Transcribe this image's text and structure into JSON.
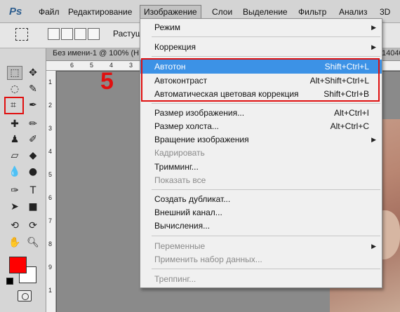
{
  "app": {
    "logo": "Ps"
  },
  "menubar": {
    "items": [
      "Файл",
      "Редактирование",
      "Изображение",
      "Слои",
      "Выделение",
      "Фильтр",
      "Анализ",
      "3D"
    ]
  },
  "options_bar": {
    "label": "Растуше"
  },
  "document": {
    "title": "Без имени-1 @ 100% (H",
    "right_tab": "14040"
  },
  "ruler": {
    "ticks": [
      "6",
      "5",
      "4",
      "3",
      "2"
    ],
    "vticks": [
      "1",
      "2",
      "3",
      "4",
      "5",
      "6",
      "7",
      "8",
      "9",
      "1"
    ]
  },
  "annotation": {
    "step": "5"
  },
  "tools": {
    "foreground_color": "#ff0000",
    "background_color": "#ffffff"
  },
  "menu": {
    "items": [
      {
        "label": "Режим",
        "submenu": true
      },
      {
        "label": "Коррекция",
        "submenu": true
      },
      {
        "label": "Автотон",
        "shortcut": "Shift+Ctrl+L",
        "highlighted": true
      },
      {
        "label": "Автоконтраст",
        "shortcut": "Alt+Shift+Ctrl+L"
      },
      {
        "label": "Автоматическая цветовая коррекция",
        "shortcut": "Shift+Ctrl+B"
      },
      {
        "label": "Размер изображения...",
        "shortcut": "Alt+Ctrl+I"
      },
      {
        "label": "Размер холста...",
        "shortcut": "Alt+Ctrl+C"
      },
      {
        "label": "Вращение изображения",
        "submenu": true
      },
      {
        "label": "Кадрировать",
        "disabled": true
      },
      {
        "label": "Тримминг..."
      },
      {
        "label": "Показать все",
        "disabled": true
      },
      {
        "label": "Создать дубликат..."
      },
      {
        "label": "Внешний канал..."
      },
      {
        "label": "Вычисления..."
      },
      {
        "label": "Переменные",
        "submenu": true,
        "disabled": true
      },
      {
        "label": "Применить набор данных...",
        "disabled": true
      },
      {
        "label": "Треппинг...",
        "disabled": true
      }
    ]
  },
  "colors": {
    "highlight": "#3c92e6",
    "annotation_red": "#e01010"
  }
}
